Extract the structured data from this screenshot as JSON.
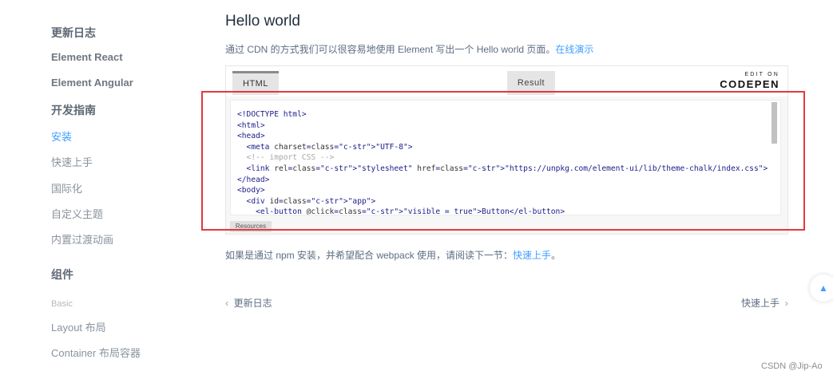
{
  "sidebar": {
    "items": [
      {
        "label": "更新日志",
        "kind": "group"
      },
      {
        "label": "Element React",
        "kind": "strong-link"
      },
      {
        "label": "Element Angular",
        "kind": "strong-link"
      },
      {
        "label": "开发指南",
        "kind": "group"
      },
      {
        "label": "安装",
        "kind": "active"
      },
      {
        "label": "快速上手",
        "kind": "normal"
      },
      {
        "label": "国际化",
        "kind": "normal"
      },
      {
        "label": "自定义主题",
        "kind": "normal"
      },
      {
        "label": "内置过渡动画",
        "kind": "normal"
      },
      {
        "label": "组件",
        "kind": "group"
      },
      {
        "label": "Basic",
        "kind": "small"
      },
      {
        "label": "Layout 布局",
        "kind": "normal"
      },
      {
        "label": "Container 布局容器",
        "kind": "normal"
      }
    ]
  },
  "main": {
    "title": "Hello world",
    "intro_text": "通过 CDN 的方式我们可以很容易地使用 Element 写出一个 Hello world 页面。",
    "intro_link": "在线演示",
    "embed": {
      "tab_html": "HTML",
      "tab_result": "Result",
      "edit_on": "EDIT ON",
      "codepen": "CODEPEN",
      "resources": "Resources",
      "code_lines": [
        "<!DOCTYPE html>",
        "<html>",
        "<head>",
        "  <meta charset=\"UTF-8\">",
        "  <!-- import CSS -->",
        "  <link rel=\"stylesheet\" href=\"https://unpkg.com/element-ui/lib/theme-chalk/index.css\">",
        "</head>",
        "<body>",
        "  <div id=\"app\">",
        "    <el-button @click=\"visible = true\">Button</el-button>"
      ]
    },
    "npm_text": "如果是通过 npm 安装，并希望配合 webpack 使用，请阅读下一节：",
    "npm_link": "快速上手",
    "npm_end": "。",
    "prev_label": "更新日志",
    "next_label": "快速上手"
  },
  "watermark": "CSDN @Jip-Ao",
  "colors": {
    "accent": "#409eff",
    "highlight": "#e33a3a"
  }
}
